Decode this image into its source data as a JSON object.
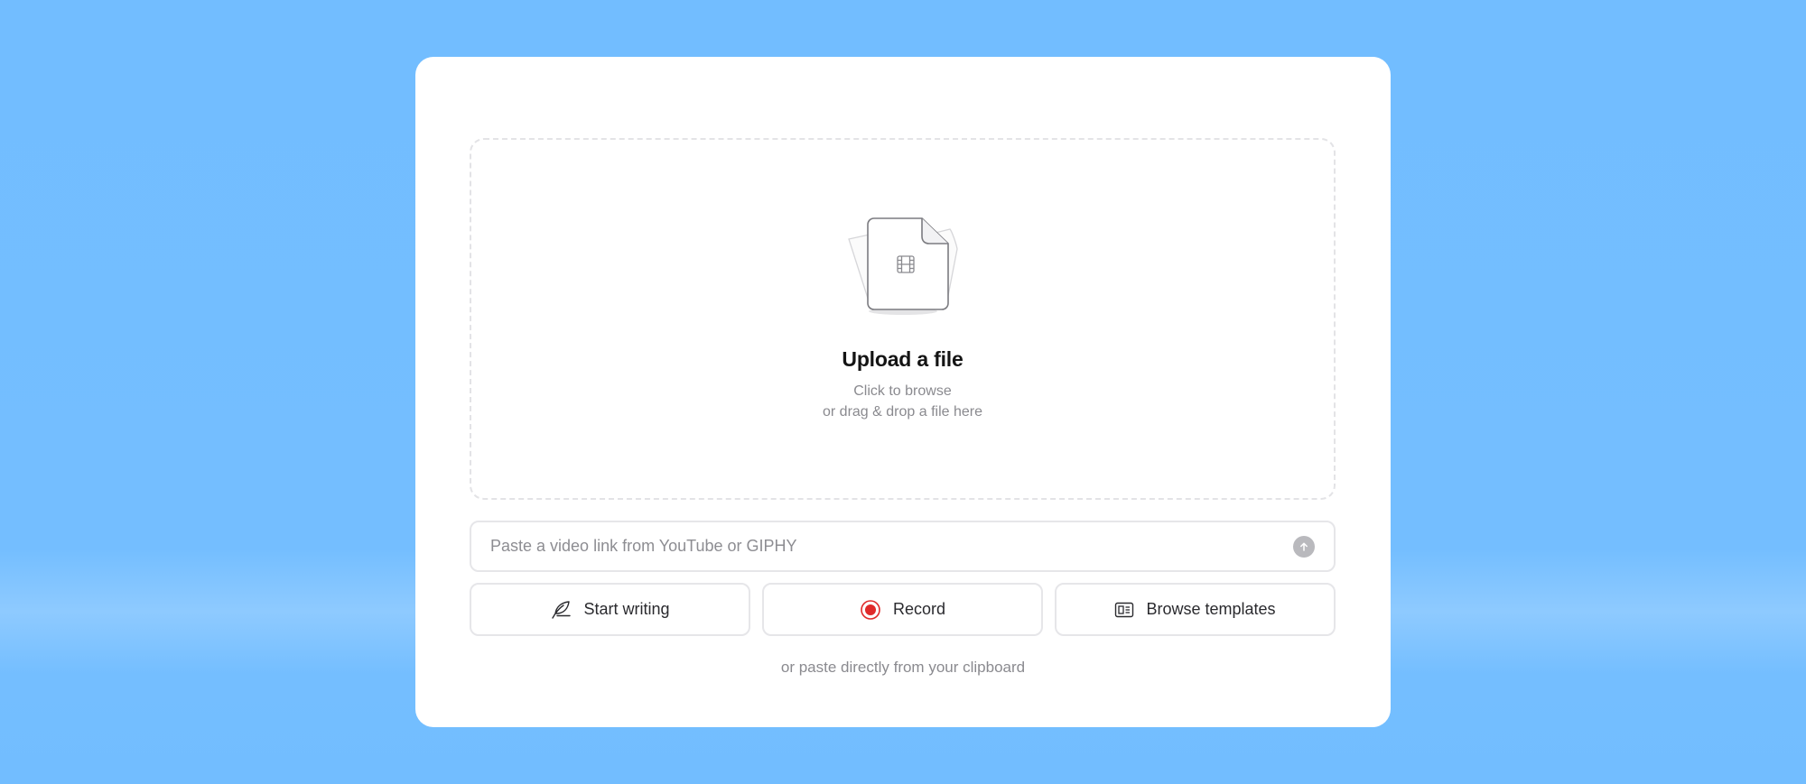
{
  "upload": {
    "title": "Upload a file",
    "line1": "Click to browse",
    "line2": "or drag & drop a file here",
    "icon": "video-file-icon"
  },
  "link": {
    "placeholder": "Paste a video link from YouTube or GIPHY",
    "value": "",
    "submit_icon": "arrow-up-icon"
  },
  "actions": [
    {
      "label": "Start writing",
      "icon": "quill-icon"
    },
    {
      "label": "Record",
      "icon": "record-icon",
      "color": "#e02a2a"
    },
    {
      "label": "Browse templates",
      "icon": "template-icon"
    }
  ],
  "hint": "or paste directly from your clipboard",
  "colors": {
    "background": "#72bdff",
    "card": "#ffffff",
    "record": "#e02a2a"
  }
}
